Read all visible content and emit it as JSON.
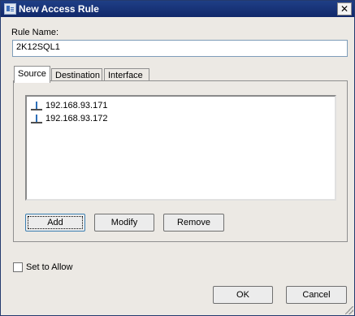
{
  "window": {
    "title": "New Access Rule",
    "close_glyph": "✕"
  },
  "form": {
    "rule_name_label": "Rule Name:",
    "rule_name_value": "2K12SQL1"
  },
  "tabs": [
    {
      "label": "Source",
      "active": true
    },
    {
      "label": "Destination",
      "active": false
    },
    {
      "label": "Interface",
      "active": false
    }
  ],
  "source_list": {
    "items": [
      {
        "icon": "network-host-icon",
        "label": "192.168.93.171"
      },
      {
        "icon": "network-host-icon",
        "label": "192.168.93.172"
      }
    ]
  },
  "list_buttons": {
    "add": "Add",
    "modify": "Modify",
    "remove": "Remove"
  },
  "allow": {
    "label": "Set to Allow",
    "checked": false
  },
  "dialog_buttons": {
    "ok": "OK",
    "cancel": "Cancel"
  }
}
